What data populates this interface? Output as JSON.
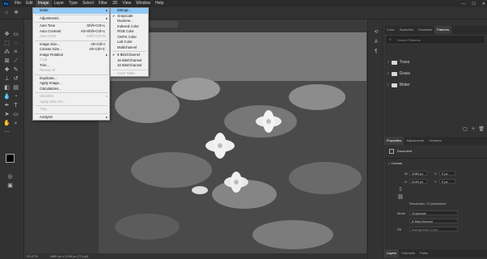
{
  "menubar": {
    "logo": "Ps",
    "items": [
      "File",
      "Edit",
      "Image",
      "Layer",
      "Type",
      "Select",
      "Filter",
      "3D",
      "View",
      "Window",
      "Help"
    ],
    "active_index": 2
  },
  "window_controls": {
    "minimize": "—",
    "maximize": "☐",
    "close": "✕"
  },
  "document_tab": "Gray/8) *",
  "status": {
    "zoom": "33.47%",
    "doc_size": "4480 px x 2240 px (72 ppi)"
  },
  "image_menu": {
    "items": [
      {
        "label": "Mode",
        "submenu": true,
        "highlight": true
      },
      {
        "sep": true
      },
      {
        "label": "Adjustments",
        "submenu": true
      },
      {
        "sep": true
      },
      {
        "label": "Auto Tone",
        "shortcut": "Shift+Ctrl+L"
      },
      {
        "label": "Auto Contrast",
        "shortcut": "Alt+Shift+Ctrl+L"
      },
      {
        "label": "Auto Color",
        "shortcut": "Shift+Ctrl+B",
        "disabled": true
      },
      {
        "sep": true
      },
      {
        "label": "Image Size...",
        "shortcut": "Alt+Ctrl+I"
      },
      {
        "label": "Canvas Size...",
        "shortcut": "Alt+Ctrl+C"
      },
      {
        "label": "Image Rotation",
        "submenu": true
      },
      {
        "label": "Crop",
        "disabled": true
      },
      {
        "label": "Trim..."
      },
      {
        "label": "Reveal All",
        "disabled": true
      },
      {
        "sep": true
      },
      {
        "label": "Duplicate..."
      },
      {
        "label": "Apply Image..."
      },
      {
        "label": "Calculations..."
      },
      {
        "sep": true
      },
      {
        "label": "Variables",
        "submenu": true,
        "disabled": true
      },
      {
        "label": "Apply Data Set...",
        "disabled": true
      },
      {
        "sep": true
      },
      {
        "label": "Trap...",
        "disabled": true
      },
      {
        "sep": true
      },
      {
        "label": "Analysis",
        "submenu": true
      }
    ]
  },
  "mode_submenu": {
    "items": [
      {
        "label": "Bitmap...",
        "highlight": true
      },
      {
        "label": "Grayscale",
        "checked": true
      },
      {
        "label": "Duotone..."
      },
      {
        "label": "Indexed Color"
      },
      {
        "label": "RGB Color"
      },
      {
        "label": "CMYK Color"
      },
      {
        "label": "Lab Color"
      },
      {
        "label": "Multichannel"
      },
      {
        "sep": true
      },
      {
        "label": "8 Bits/Channel",
        "checked": true
      },
      {
        "label": "16 Bits/Channel"
      },
      {
        "label": "32 Bits/Channel"
      },
      {
        "sep": true
      },
      {
        "label": "Color Table...",
        "disabled": true
      }
    ]
  },
  "panels": {
    "top_tabs": [
      "Color",
      "Swatches",
      "Gradients",
      "Patterns"
    ],
    "top_active": 3,
    "search_placeholder": "Search Patterns",
    "folders": [
      "Trees",
      "Grass",
      "Water"
    ],
    "props_tabs": [
      "Properties",
      "Adjustments",
      "Libraries"
    ],
    "props_active": 0,
    "document_label": "Document",
    "canvas_label": "Canvas",
    "w_label": "W",
    "w_value": "3380 px",
    "h_label": "H",
    "h_value": "2240 px",
    "x_label": "X",
    "x_value": "0 px",
    "y_label": "Y",
    "y_value": "0 px",
    "resolution": "Resolution: 72 pixels/inch",
    "mode_label": "Mode",
    "mode_value": "Grayscale",
    "bits_value": "8 Bits/Channel",
    "fill_label": "Fill",
    "fill_value": "Background Color",
    "bottom_tabs": [
      "Layers",
      "Channels",
      "Paths"
    ],
    "bottom_active": 0
  }
}
